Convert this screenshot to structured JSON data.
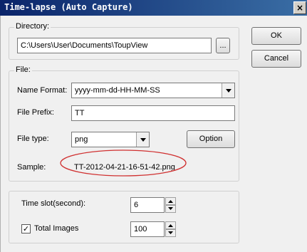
{
  "window": {
    "title": "Time-lapse (Auto Capture)",
    "close_label": "×"
  },
  "buttons": {
    "ok": "OK",
    "cancel": "Cancel",
    "browse": "...",
    "option": "Option"
  },
  "directory": {
    "group_label": "Directory:",
    "value": "C:\\Users\\User\\Documents\\ToupView"
  },
  "file": {
    "group_label": "File:",
    "name_format_label": "Name Format:",
    "name_format_value": "yyyy-mm-dd-HH-MM-SS",
    "prefix_label": "File Prefix:",
    "prefix_value": "TT",
    "type_label": "File type:",
    "type_value": "png",
    "sample_label": "Sample:",
    "sample_value": "TT-2012-04-21-16-51-42.png"
  },
  "timing": {
    "slot_label": "Time slot(second):",
    "slot_value": "6",
    "total_label": "Total Images",
    "total_value": "100",
    "total_checked": true
  },
  "colors": {
    "titlebar": "#0a246a",
    "annotation": "#d03030"
  },
  "icons": {
    "dropdown": "triangle-down-icon",
    "spin_up": "triangle-up-icon",
    "spin_down": "triangle-down-icon",
    "check": "check-icon",
    "close": "close-icon"
  }
}
